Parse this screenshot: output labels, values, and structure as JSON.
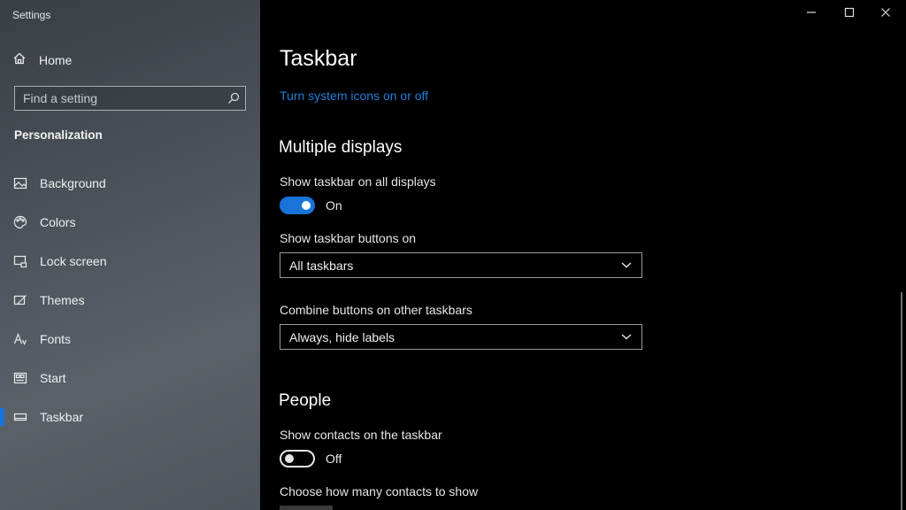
{
  "window": {
    "title": "Settings",
    "controls": {
      "minimize": "minimize",
      "maximize": "maximize",
      "close": "close"
    }
  },
  "sidebar": {
    "home_label": "Home",
    "search_placeholder": "Find a setting",
    "section_label": "Personalization",
    "items": [
      {
        "label": "Background",
        "icon": "image-icon"
      },
      {
        "label": "Colors",
        "icon": "palette-icon"
      },
      {
        "label": "Lock screen",
        "icon": "lock-screen-icon"
      },
      {
        "label": "Themes",
        "icon": "themes-icon"
      },
      {
        "label": "Fonts",
        "icon": "fonts-icon"
      },
      {
        "label": "Start",
        "icon": "start-icon"
      },
      {
        "label": "Taskbar",
        "icon": "taskbar-icon",
        "selected": true
      }
    ],
    "accent_color": "#1a73d9"
  },
  "main": {
    "title": "Taskbar",
    "link_text": "Turn system icons on or off",
    "multiple_displays": {
      "heading": "Multiple displays",
      "show_all_label": "Show taskbar on all displays",
      "show_all_state": "On",
      "buttons_on_label": "Show taskbar buttons on",
      "buttons_on_value": "All taskbars",
      "combine_label": "Combine buttons on other taskbars",
      "combine_value": "Always, hide labels"
    },
    "people": {
      "heading": "People",
      "contacts_label": "Show contacts on the taskbar",
      "contacts_state": "Off",
      "how_many_label": "Choose how many contacts to show"
    },
    "link_color": "#1e7fd8"
  }
}
